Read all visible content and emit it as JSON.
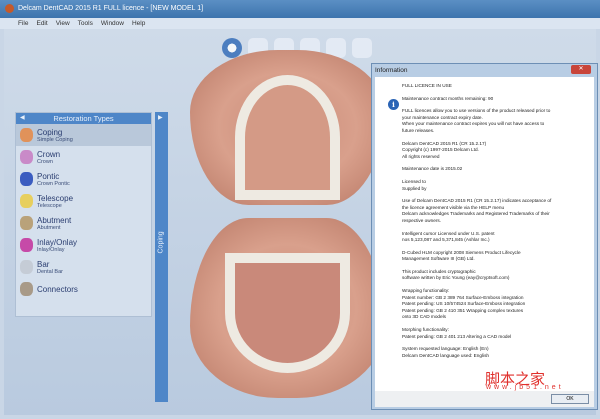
{
  "window": {
    "title": "Delcam DentCAD 2015 R1 FULL licence - [NEW MODEL 1]"
  },
  "menu": [
    "File",
    "Edit",
    "View",
    "Tools",
    "Window",
    "Help"
  ],
  "panel": {
    "title": "Restoration Types",
    "side_tab": "Coping",
    "items": [
      {
        "label": "Coping",
        "sub": "Simple Coping",
        "color": "#e0925a"
      },
      {
        "label": "Crown",
        "sub": "Crown",
        "color": "#c98ac8"
      },
      {
        "label": "Pontic",
        "sub": "Crown Pontic",
        "color": "#3a5cc0"
      },
      {
        "label": "Telescope",
        "sub": "Telescope",
        "color": "#e7cf5e"
      },
      {
        "label": "Abutment",
        "sub": "Abutment",
        "color": "#b9a27a"
      },
      {
        "label": "Inlay/Onlay",
        "sub": "Inlay/Onlay",
        "color": "#c64aa8"
      },
      {
        "label": "Bar",
        "sub": "Dental Bar",
        "color": "#c5ccd6"
      },
      {
        "label": "Connectors",
        "sub": "",
        "color": "#a89a88"
      }
    ]
  },
  "dialog": {
    "title": "Information",
    "close": "✕",
    "ok": "OK",
    "paragraphs": [
      "FULL LICENCE IN USE",
      "Maintenance contract months remaining: 90",
      "FULL licences allow you to use versions of the product released prior to\nyour maintenance contract expiry date.\nWhen your maintenance contract expires you will not have access to\nfuture releases.",
      "Delcam DentCAD 2015 R1 (CR 15.2.17)\nCopyright (c) 1997-2015 Delcam Ltd.\nAll rights reserved",
      "Maintenance date is 2015.02",
      "Licensed to\nSupplied by",
      "Use of Delcam DentCAD 2015 R1 (CR 15.2.17) indicates acceptance of\nthe licence agreement visible via the HELP menu\nDelcam acknowledges Trademarks and Registered Trademarks of their\nrespective owners.",
      "Intelligent cursor Licensed under U.S. patent\nnos 5,123,087 and 5,371,845 (Ashlar Inc.)",
      "D-Cubed HLM copyright 2008 Siemens Product Lifecycle\nManagement Software III (GB) Ltd.",
      "This product includes cryptographic\nsoftware written by Eric Young (eay@cryptsoft.com)",
      "Wrapping functionality:\nPatent number: GB 2 389 764 Surface-Emboss integration\nPatent pending: US 10/574524 Surface-Emboss integration\nPatent pending: GB 2 410 351 Wrapping complex textures\n                              onto 3D CAD models",
      "Morphing functionality:\nPatent pending: GB 2 401 213 Altering a CAD model",
      "System requested language: English (En)\nDelcam DentCAD language used: English"
    ]
  },
  "watermark": {
    "text": "脚本之家",
    "url": "www.jb51.net"
  }
}
